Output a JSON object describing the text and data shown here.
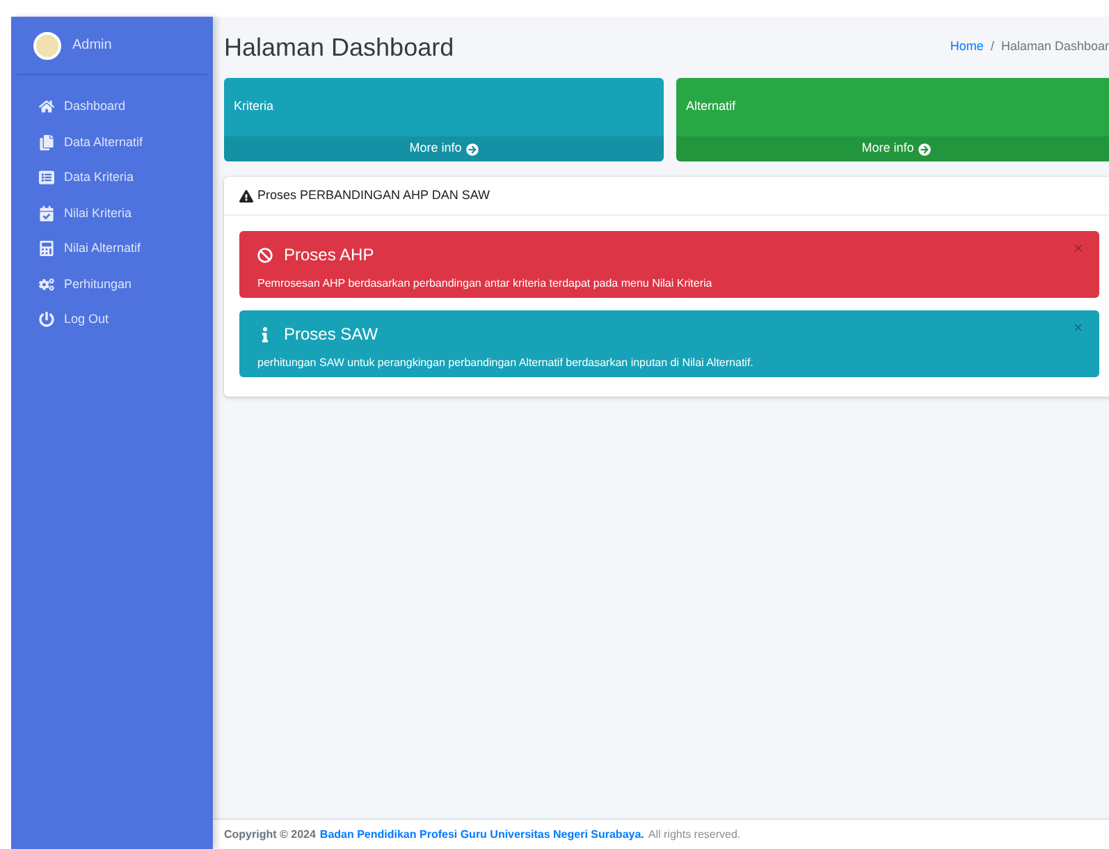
{
  "sidebar": {
    "user": "Admin",
    "items": [
      {
        "label": "Dashboard"
      },
      {
        "label": "Data Alternatif"
      },
      {
        "label": "Data Kriteria"
      },
      {
        "label": "Nilai Kriteria"
      },
      {
        "label": "Nilai Alternatif"
      },
      {
        "label": "Perhitungan"
      },
      {
        "label": "Log Out"
      }
    ]
  },
  "header": {
    "title": "Halaman Dashboard",
    "breadcrumb": [
      {
        "label": "Home",
        "link": true
      },
      {
        "label": "Halaman Dashboar",
        "link": false
      }
    ],
    "breadcrumb_separator": "/"
  },
  "small_boxes": [
    {
      "label": "Kriteria",
      "more": "More info",
      "color": "#17a2b8"
    },
    {
      "label": "Alternatif",
      "more": "More info",
      "color": "#28a745"
    }
  ],
  "card": {
    "title": "Proses PERBANDINGAN AHP DAN SAW",
    "alerts": [
      {
        "kind": "danger",
        "title": "Proses AHP",
        "text": "Pemrosesan AHP berdasarkan perbandingan antar kriteria terdapat pada menu Nilai Kriteria",
        "close": "×"
      },
      {
        "kind": "info",
        "title": "Proses SAW",
        "text": "perhitungan SAW untuk perangkingan perbandingan Alternatif berdasarkan inputan di Nilai Alternatif.",
        "close": "×"
      }
    ]
  },
  "footer": {
    "copyright": "Copyright © 2024",
    "link": "Badan Pendidikan Profesi Guru Universitas Negeri Surabaya.",
    "rights": "All rights reserved."
  }
}
